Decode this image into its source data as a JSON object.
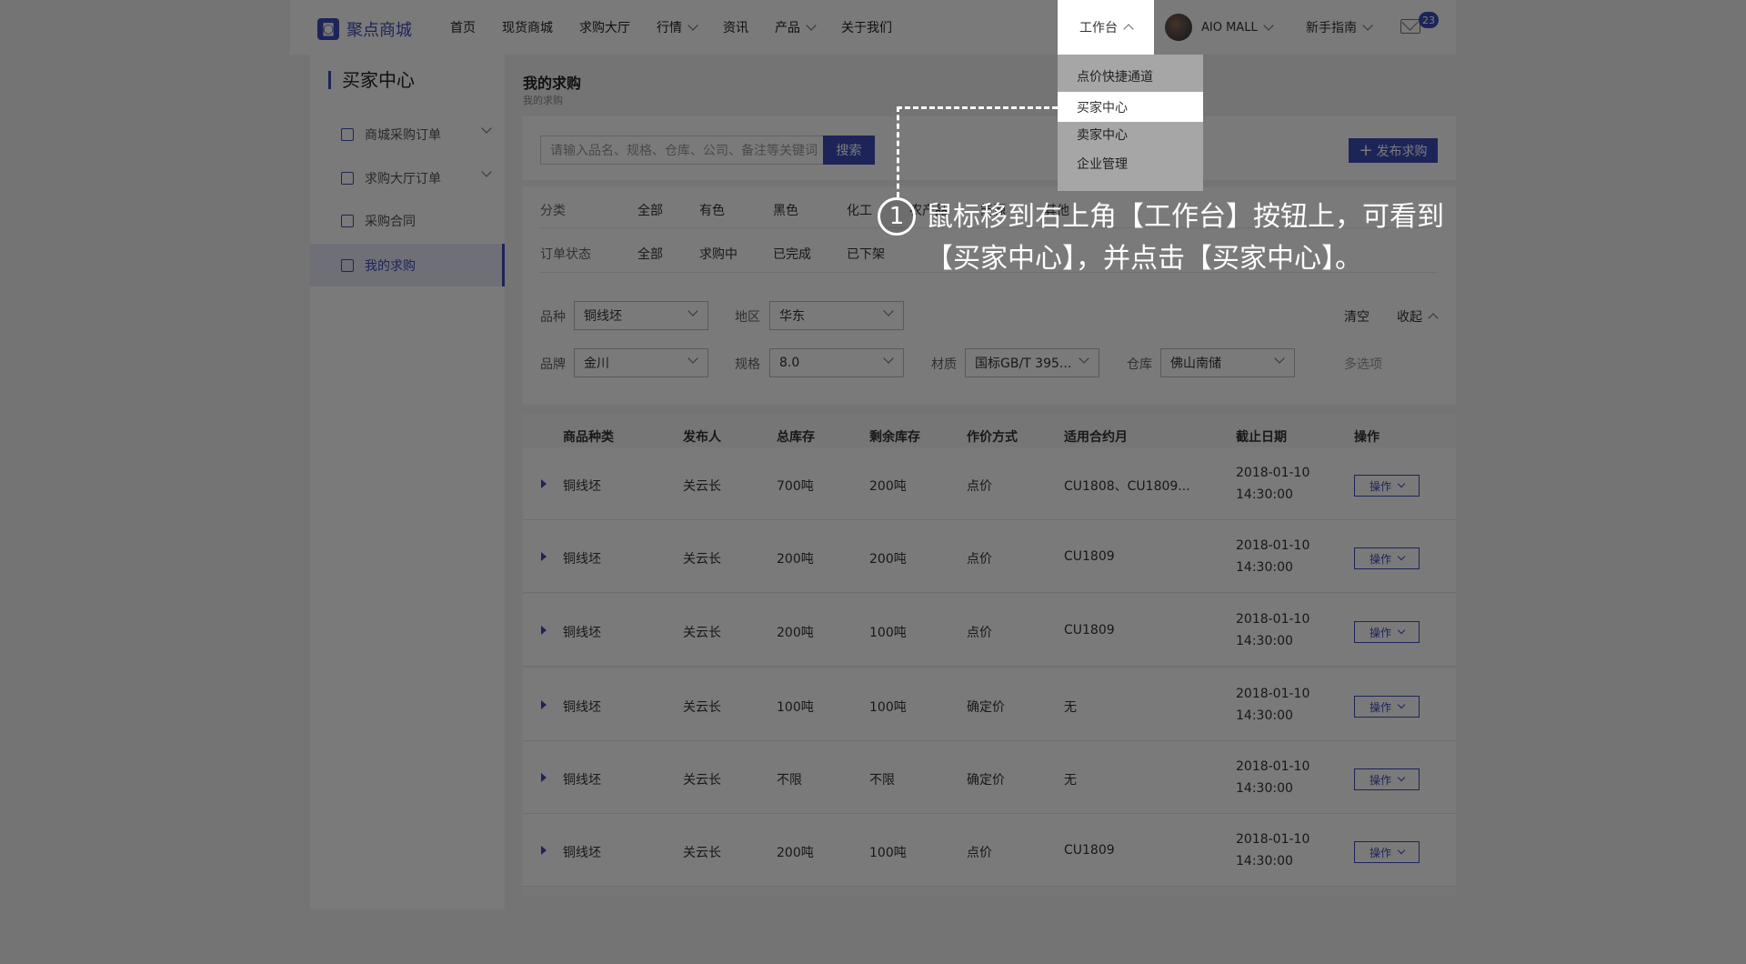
{
  "header": {
    "logo": "聚点商城",
    "nav": [
      {
        "label": "首页"
      },
      {
        "label": "现货商城"
      },
      {
        "label": "求购大厅"
      },
      {
        "label": "行情"
      },
      {
        "label": "资讯"
      },
      {
        "label": "产品"
      },
      {
        "label": "关于我们"
      }
    ],
    "workbench": "工作台",
    "user": "AIO MALL",
    "guide": "新手指南",
    "mail_count": "23"
  },
  "dropdown": {
    "items": [
      "点价快捷通道",
      "买家中心",
      "卖家中心",
      "企业管理"
    ]
  },
  "sidebar": {
    "title": "买家中心",
    "items": [
      "商城采购订单",
      "求购大厅订单",
      "采购合同",
      "我的求购"
    ]
  },
  "page": {
    "title": "我的求购",
    "breadcrumb": "我的求购",
    "search_placeholder": "请输入品名、规格、仓库、公司、备注等关键词",
    "search_button": "搜索",
    "publish_button": "发布求购"
  },
  "filters": {
    "category_label": "分类",
    "categories": [
      "全部",
      "有色",
      "黑色",
      "化工",
      "农产品",
      "能源",
      "其他"
    ],
    "status_label": "订单状态",
    "statuses": [
      "全部",
      "求购中",
      "已完成",
      "已下架"
    ],
    "variety_label": "品种",
    "variety": "铜线坯",
    "region_label": "地区",
    "region": "华东",
    "brand_label": "品牌",
    "brand": "金川",
    "spec_label": "规格",
    "spec": "8.0",
    "material_label": "材质",
    "material": "国标GB/T 395...",
    "warehouse_label": "仓库",
    "warehouse": "佛山南储",
    "clear": "清空",
    "collapse": "收起",
    "multi": "多选项"
  },
  "table": {
    "headers": [
      "商品种类",
      "发布人",
      "总库存",
      "剩余库存",
      "作价方式",
      "适用合约月",
      "截止日期",
      "操作"
    ],
    "op_label": "操作",
    "rows": [
      {
        "type": "铜线坯",
        "publisher": "关云长",
        "total": "700吨",
        "remain": "200吨",
        "pricing": "点价",
        "contract": "CU1808、CU1809...",
        "date": "2018-01-10",
        "time": "14:30:00"
      },
      {
        "type": "铜线坯",
        "publisher": "关云长",
        "total": "200吨",
        "remain": "200吨",
        "pricing": "点价",
        "contract": "CU1809",
        "date": "2018-01-10",
        "time": "14:30:00"
      },
      {
        "type": "铜线坯",
        "publisher": "关云长",
        "total": "200吨",
        "remain": "100吨",
        "pricing": "点价",
        "contract": "CU1809",
        "date": "2018-01-10",
        "time": "14:30:00"
      },
      {
        "type": "铜线坯",
        "publisher": "关云长",
        "total": "100吨",
        "remain": "100吨",
        "pricing": "确定价",
        "contract": "无",
        "date": "2018-01-10",
        "time": "14:30:00"
      },
      {
        "type": "铜线坯",
        "publisher": "关云长",
        "total": "不限",
        "remain": "不限",
        "pricing": "确定价",
        "contract": "无",
        "date": "2018-01-10",
        "time": "14:30:00"
      },
      {
        "type": "铜线坯",
        "publisher": "关云长",
        "total": "200吨",
        "remain": "100吨",
        "pricing": "点价",
        "contract": "CU1809",
        "date": "2018-01-10",
        "time": "14:30:00"
      }
    ]
  },
  "annotation": {
    "step": "1",
    "text": "鼠标移到右上角【工作台】按钮上，可看到【买家中心】，并点击【买家中心】。"
  },
  "colors": {
    "accent": "#3d4db8",
    "background": "#f2f3f5"
  }
}
